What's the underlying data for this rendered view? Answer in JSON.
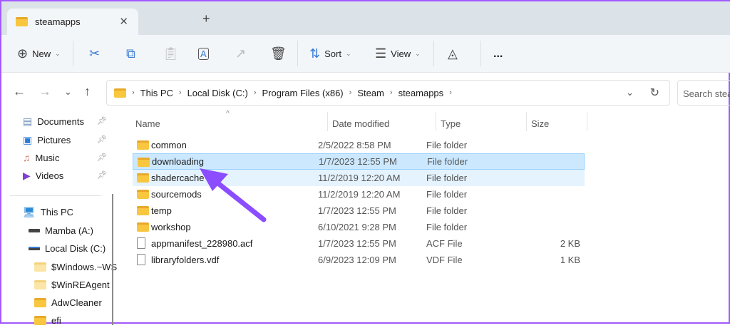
{
  "tab": {
    "title": "steamapps"
  },
  "toolbar": {
    "new": "New",
    "sort": "Sort",
    "view": "View",
    "more": "..."
  },
  "address": {
    "segments": [
      "This PC",
      "Local Disk (C:)",
      "Program Files (x86)",
      "Steam",
      "steamapps"
    ],
    "search_placeholder": "Search steamapps"
  },
  "sidebar": {
    "quick": [
      {
        "label": "Documents"
      },
      {
        "label": "Pictures"
      },
      {
        "label": "Music"
      },
      {
        "label": "Videos"
      }
    ],
    "tree": [
      {
        "label": "This PC"
      },
      {
        "label": "Mamba (A:)"
      },
      {
        "label": "Local Disk (C:)"
      },
      {
        "label": "$Windows.~WS"
      },
      {
        "label": "$WinREAgent"
      },
      {
        "label": "AdwCleaner"
      },
      {
        "label": "efi"
      }
    ]
  },
  "columns": {
    "name": "Name",
    "date": "Date modified",
    "type": "Type",
    "size": "Size"
  },
  "files": [
    {
      "name": "common",
      "date": "2/5/2022 8:58 PM",
      "type": "File folder",
      "size": ""
    },
    {
      "name": "downloading",
      "date": "1/7/2023 12:55 PM",
      "type": "File folder",
      "size": ""
    },
    {
      "name": "shadercache",
      "date": "11/2/2019 12:20 AM",
      "type": "File folder",
      "size": ""
    },
    {
      "name": "sourcemods",
      "date": "11/2/2019 12:20 AM",
      "type": "File folder",
      "size": ""
    },
    {
      "name": "temp",
      "date": "1/7/2023 12:55 PM",
      "type": "File folder",
      "size": ""
    },
    {
      "name": "workshop",
      "date": "6/10/2021 9:28 PM",
      "type": "File folder",
      "size": ""
    },
    {
      "name": "appmanifest_228980.acf",
      "date": "1/7/2023 12:55 PM",
      "type": "ACF File",
      "size": "2 KB"
    },
    {
      "name": "libraryfolders.vdf",
      "date": "6/9/2023 12:09 PM",
      "type": "VDF File",
      "size": "1 KB"
    }
  ],
  "colors": {
    "accent": "#a259ff",
    "selected": "#cce8ff",
    "folder": "#f8c63f"
  }
}
